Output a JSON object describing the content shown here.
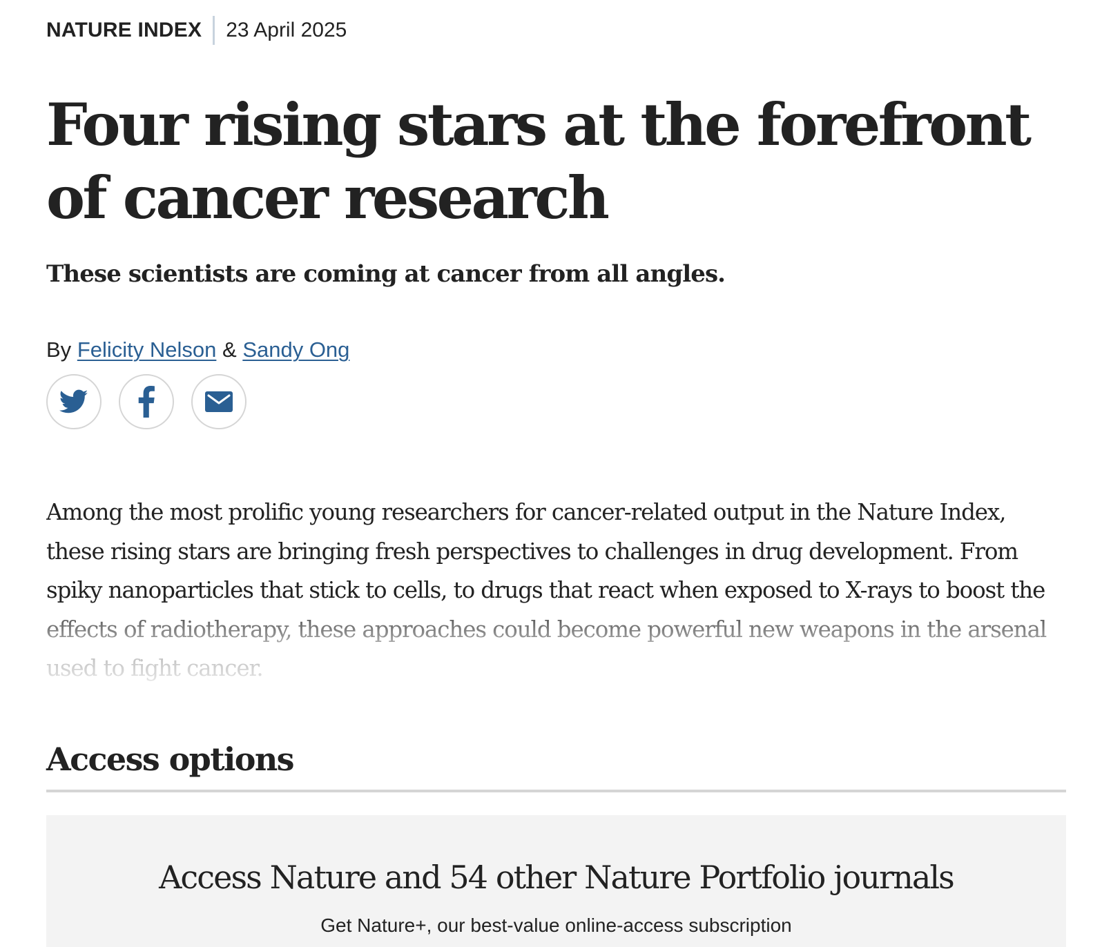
{
  "meta": {
    "section": "NATURE INDEX",
    "date": "23 April 2025"
  },
  "article": {
    "title": "Four rising stars at the forefront of cancer research",
    "standfirst": "These scientists are coming at cancer from all angles.",
    "byline": {
      "prefix": "By",
      "authors": [
        "Felicity Nelson",
        "Sandy Ong"
      ],
      "separator": "&"
    },
    "body": "Among the most prolific young researchers for cancer-related output in the Nature Index, these rising stars are bringing fresh perspectives to challenges in drug development. From spiky nanoparticles that stick to cells, to drugs that react when exposed to X-rays to boost the effects of radiotherapy, these approaches could become powerful new weapons in the arsenal used to fight cancer."
  },
  "share": {
    "icons": [
      "twitter-icon",
      "facebook-icon",
      "email-icon"
    ],
    "icon_color": "#2a5f93"
  },
  "access": {
    "heading": "Access options",
    "box_title": "Access Nature and 54 other Nature Portfolio journals",
    "box_subtitle": "Get Nature+, our best-value online-access subscription"
  },
  "colors": {
    "link": "#2a5f93",
    "text": "#222222",
    "panel": "#f3f3f3"
  }
}
